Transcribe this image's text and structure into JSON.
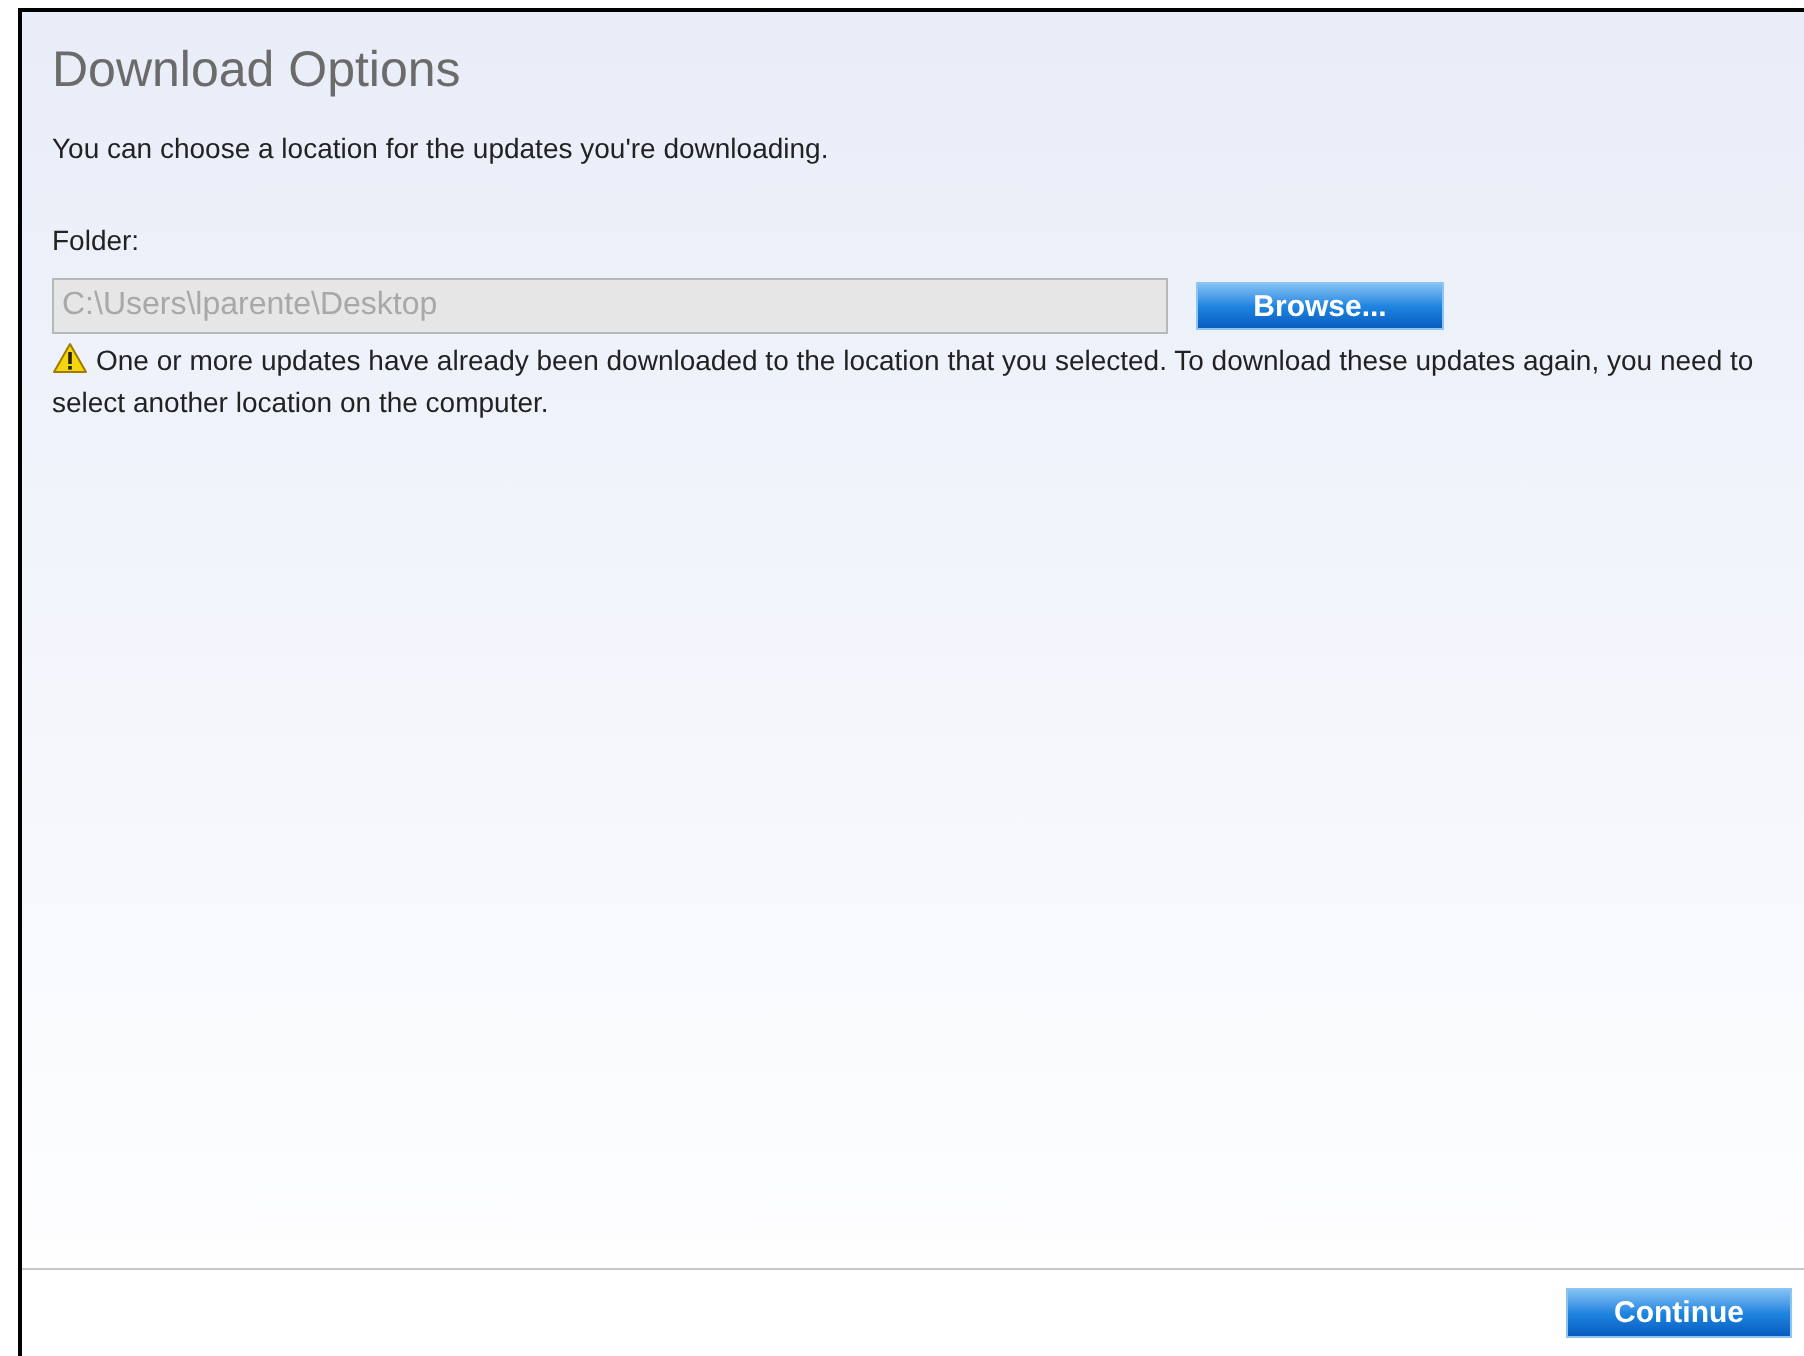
{
  "title": "Download Options",
  "description": "You can choose a location for the updates you're downloading.",
  "folder": {
    "label": "Folder:",
    "value": "C:\\Users\\lparente\\Desktop",
    "disabled": true
  },
  "browse_button": "Browse...",
  "warning": "One or more updates have already been downloaded to the location that you selected. To download these updates again, you need to select another location on the computer.",
  "continue_button": "Continue"
}
